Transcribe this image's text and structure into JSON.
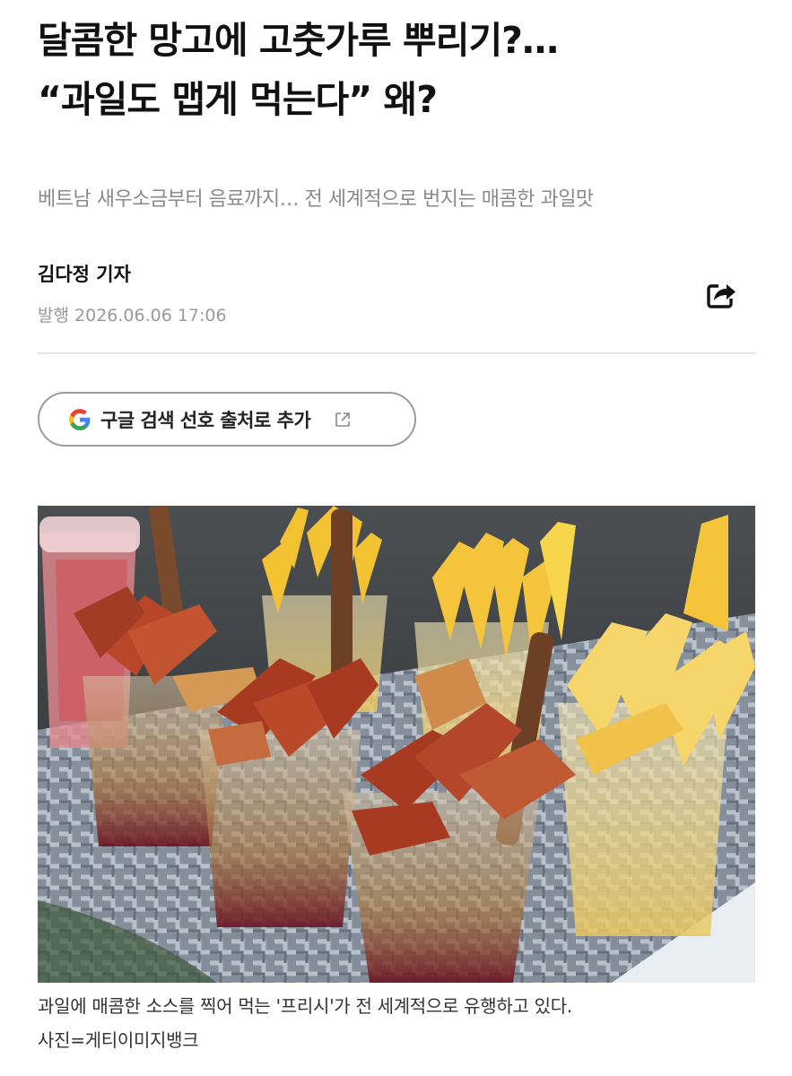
{
  "article": {
    "headline_line1": "달콤한 망고에 고춧가루 뿌리기?…",
    "headline_line2": "“과일도 맵게 먹는다” 왜?",
    "subtitle": "베트남 새우소금부터 음료까지… 전 세계적으로 번지는 매콤한 과일맛",
    "author": "김다정 기자",
    "published_label": "발행",
    "published_datetime": "2026.06.06 17:06"
  },
  "actions": {
    "share_icon": "share-icon",
    "preferred_source_label": "구글 검색 선호 출처로 추가",
    "preferred_source_icon": "google-g-icon",
    "external_link_icon": "external-link-icon"
  },
  "photo": {
    "caption_line1": "과일에 매콤한 소스를 찍어 먹는 '프리시'가 전 세계적으로 유행하고 있다.",
    "caption_line2": "사진=게티이미지뱅크"
  },
  "colors": {
    "text": "#111111",
    "subtitle": "#8a8a8a",
    "meta": "#9a9a9a",
    "divider": "#e5e5e5",
    "button_border": "#9c9c9c"
  }
}
